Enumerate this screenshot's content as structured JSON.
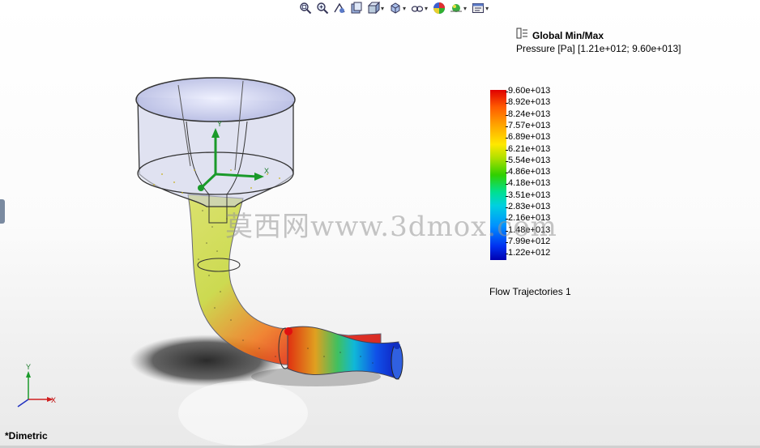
{
  "toolbar": {
    "icons": [
      "zoom-to-fit-icon",
      "zoom-to-area-icon",
      "previous-view-icon",
      "section-view-icon",
      "view-orientation-icon",
      "display-style-icon",
      "hide-show-items-icon",
      "edit-appearance-icon",
      "apply-scene-icon",
      "view-settings-icon"
    ]
  },
  "legend": {
    "title": "Global Min/Max",
    "range": "Pressure [Pa] [1.21e+012; 9.60e+013]",
    "ticks": [
      "9.60e+013",
      "8.92e+013",
      "8.24e+013",
      "7.57e+013",
      "6.89e+013",
      "6.21e+013",
      "5.54e+013",
      "4.86e+013",
      "4.18e+013",
      "3.51e+013",
      "2.83e+013",
      "2.16e+013",
      "1.48e+013",
      "7.99e+012",
      "1.22e+012"
    ]
  },
  "trajectories_label": "Flow Trajectories 1",
  "view_name": "*Dimetric",
  "watermark": "莫西网www.3dmox.com",
  "triad": {
    "x": "X",
    "y": "Y"
  },
  "origin_triad": {
    "x": "X",
    "y": "Y"
  }
}
